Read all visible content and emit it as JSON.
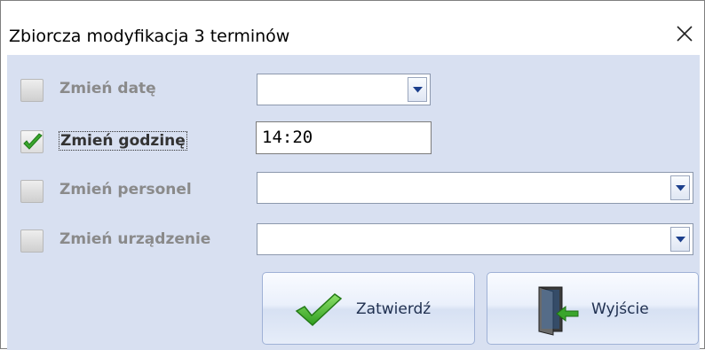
{
  "window": {
    "title": "Zbiorcza modyfikacja 3 terminów",
    "close_label": "×"
  },
  "form": {
    "rows": [
      {
        "label": "Zmień datę",
        "checked": false,
        "control": "date-dropdown",
        "value": ""
      },
      {
        "label": "Zmień godzinę",
        "checked": true,
        "control": "time-input",
        "value": "14:20"
      },
      {
        "label": "Zmień personel",
        "checked": false,
        "control": "dropdown",
        "value": ""
      },
      {
        "label": "Zmień urządzenie",
        "checked": false,
        "control": "dropdown",
        "value": ""
      }
    ]
  },
  "buttons": {
    "confirm_label": "Zatwierdź",
    "exit_label": "Wyjście"
  },
  "icons": {
    "close": "close-icon",
    "checkmark": "checkmark-icon",
    "confirm": "green-checkmark-icon",
    "exit": "exit-door-icon",
    "dropdown_arrow": "dropdown-arrow-icon"
  },
  "colors": {
    "panel_background": "#d8e0f1",
    "label_disabled": "#8a8a8a",
    "label_active": "#333333",
    "checkmark_green": "#3aa52c",
    "dropdown_arrow": "#1c3f8c"
  }
}
